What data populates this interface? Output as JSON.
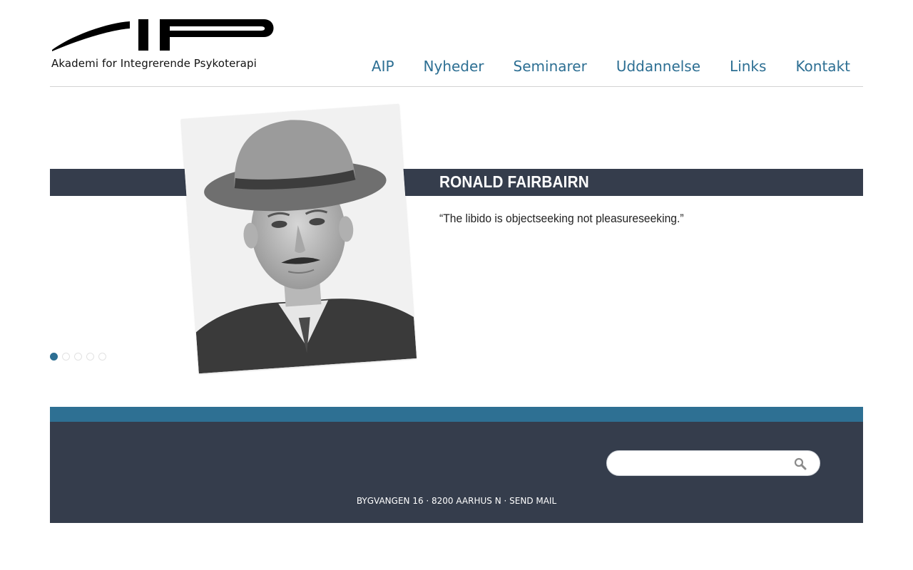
{
  "logo": {
    "mark": "AIP",
    "tagline": "Akademi for Integrerende Psykoterapi"
  },
  "nav": {
    "items": [
      "AIP",
      "Nyheder",
      "Seminarer",
      "Uddannelse",
      "Links",
      "Kontakt"
    ]
  },
  "slider": {
    "name": "RONALD FAIRBAIRN",
    "quote": "“The libido is objectseeking not pleasureseeking.”",
    "dot_count": 5,
    "active_dot": 1
  },
  "footer": {
    "search_placeholder": "",
    "address": "BYGVANGEN 16 · 8200 AARHUS N · ",
    "mail_link": "SEND MAIL"
  },
  "colors": {
    "accent": "#2d6f93",
    "dark": "#353d4c"
  },
  "icons": {
    "search": "search-icon"
  }
}
